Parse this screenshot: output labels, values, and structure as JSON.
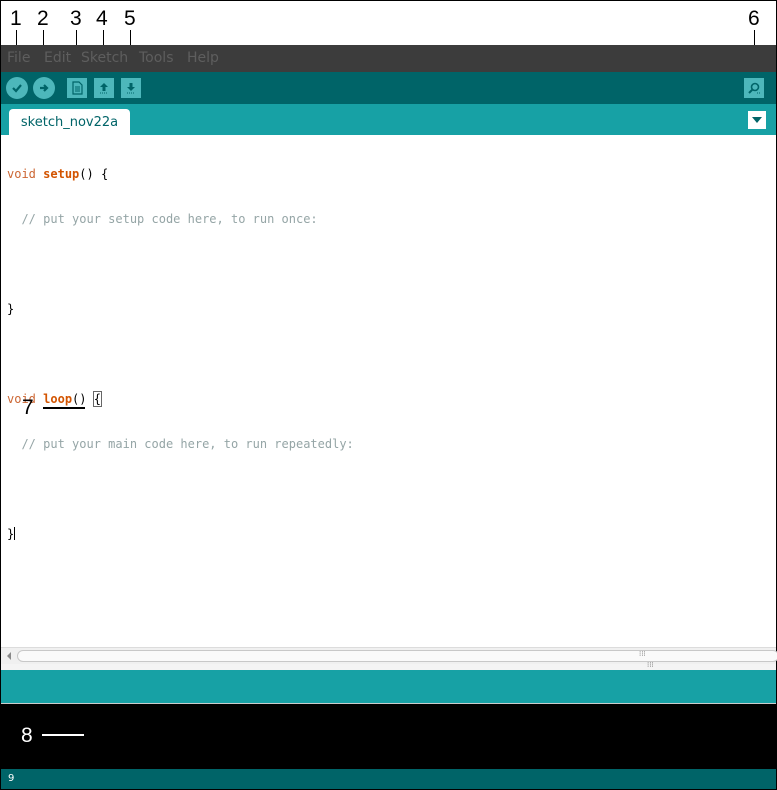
{
  "annotations": {
    "labels": [
      "1",
      "2",
      "3",
      "4",
      "5",
      "6",
      "7",
      "8"
    ]
  },
  "menu": {
    "items": [
      "File",
      "Edit",
      "Sketch",
      "Tools",
      "Help"
    ]
  },
  "toolbar": {
    "buttons": [
      {
        "name": "verify",
        "icon": "check-icon"
      },
      {
        "name": "upload",
        "icon": "arrow-right-icon"
      },
      {
        "name": "new",
        "icon": "document-icon"
      },
      {
        "name": "open",
        "icon": "arrow-up-icon"
      },
      {
        "name": "save",
        "icon": "arrow-down-icon"
      },
      {
        "name": "serial-monitor",
        "icon": "magnifier-icon"
      }
    ]
  },
  "tabs": {
    "active": "sketch_nov22a"
  },
  "editor": {
    "lines": [
      {
        "kw": "void",
        "fn": "setup",
        "rest": "() {"
      },
      {
        "comment": "  // put your setup code here, to run once:"
      },
      {
        "text": ""
      },
      {
        "text": "}"
      },
      {
        "text": ""
      },
      {
        "kw": "void",
        "fn": "loop",
        "rest": "() ",
        "bracket": "{"
      },
      {
        "comment": "  // put your main code here, to run repeatedly:"
      },
      {
        "text": ""
      },
      {
        "text": "}"
      }
    ]
  },
  "footer": {
    "line_number": "9"
  },
  "colors": {
    "menubar": "#3c3c3c",
    "toolbar": "#006468",
    "tabbar": "#17a1a5",
    "button": "#4db7bb",
    "console": "#000000"
  }
}
